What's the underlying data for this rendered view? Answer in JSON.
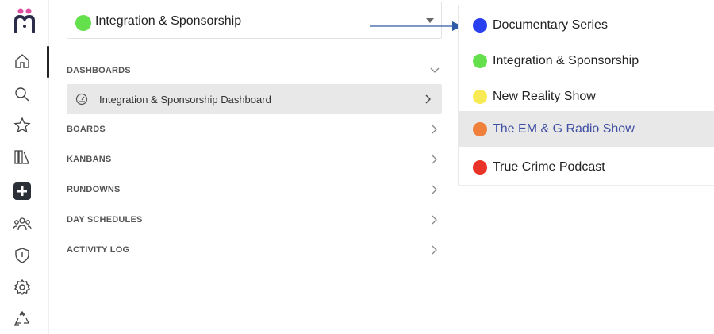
{
  "board_selector": {
    "label": "Integration & Sponsorship",
    "dot_color": "#63e04c"
  },
  "sections": {
    "dashboards": "DASHBOARDS",
    "dashboard_item": "Integration & Sponsorship Dashboard",
    "boards": "BOARDS",
    "kanbans": "KANBANS",
    "rundowns": "RUNDOWNS",
    "day_schedules": "DAY SCHEDULES",
    "activity_log": "ACTIVITY LOG"
  },
  "dropdown": {
    "options": [
      {
        "label": "Documentary Series",
        "color": "#2a3ff0"
      },
      {
        "label": "Integration & Sponsorship",
        "color": "#63e04c"
      },
      {
        "label": "New Reality Show",
        "color": "#f8ea55"
      },
      {
        "label": "The EM & G Radio Show",
        "color": "#ef7f3b",
        "selected": true
      },
      {
        "label": "True Crime Podcast",
        "color": "#ea3328"
      }
    ]
  },
  "sidebar_icons": [
    "home-icon",
    "search-icon",
    "star-icon",
    "library-icon",
    "add-icon",
    "team-icon",
    "shield-icon",
    "settings-icon",
    "recycle-icon"
  ],
  "colors": {
    "accent_text": "#3f4fa3",
    "arrow": "#2f5aa8"
  }
}
